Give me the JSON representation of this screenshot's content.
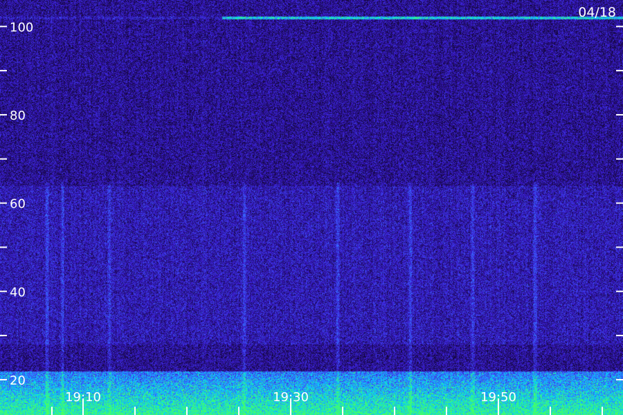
{
  "chart_data": {
    "type": "heatmap",
    "title": "",
    "date_label": "04/18",
    "xlabel": "",
    "ylabel": "",
    "y_range": [
      12,
      106
    ],
    "y_ticks": [
      100,
      80,
      60,
      40,
      20
    ],
    "y_minor_ticks": [
      90,
      70,
      50,
      30
    ],
    "x_range": [
      "19:02",
      "19:62"
    ],
    "x_tick_labels": [
      {
        "label": "19:10",
        "minute": 10
      },
      {
        "label": "19:30",
        "minute": 30
      },
      {
        "label": "19:50",
        "minute": 50
      }
    ],
    "x_minor_ticks_minutes": [
      7,
      10,
      15,
      20,
      25,
      30,
      35,
      40,
      45,
      50,
      55,
      60
    ],
    "grid": false,
    "colormap": [
      "#000000",
      "#1c0a55",
      "#3a1ad0",
      "#3c64ff",
      "#00d2ff",
      "#46ff64"
    ],
    "features": {
      "strong_line_at": 102,
      "low_band": [
        12,
        22
      ],
      "diffuse_band": [
        28,
        64
      ],
      "vertical_streaks_minutes": [
        6.5,
        8.0,
        12.5,
        25.5,
        34.5,
        41.5,
        47.5,
        53.5
      ]
    }
  }
}
